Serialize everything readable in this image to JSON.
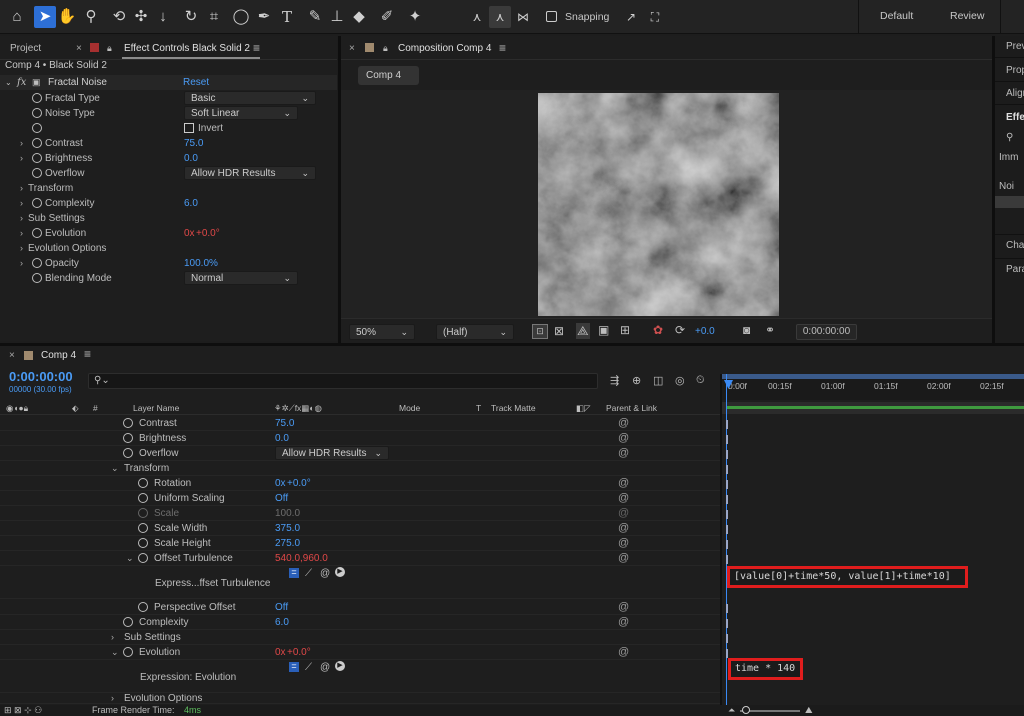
{
  "toolbar": {
    "snapping_label": "Snapping",
    "workspaces": [
      "Default",
      "Review"
    ]
  },
  "left_panel": {
    "tab_project": "Project",
    "tab_effect_controls": "Effect Controls Black Solid 2",
    "layer_path": "Comp 4 • Black Solid 2",
    "effect_name": "Fractal Noise",
    "reset_label": "Reset",
    "props": [
      {
        "label": "Fractal Type",
        "dropdown": "Basic"
      },
      {
        "label": "Noise Type",
        "dropdown": "Soft Linear"
      },
      {
        "label": "",
        "checkbox": "Invert"
      },
      {
        "label": "Contrast",
        "value": "75.0"
      },
      {
        "label": "Brightness",
        "value": "0.0"
      },
      {
        "label": "Overflow",
        "dropdown": "Allow HDR Results"
      },
      {
        "label": "Transform"
      },
      {
        "label": "Complexity",
        "value": "6.0"
      },
      {
        "label": "Sub Settings"
      },
      {
        "label": "Evolution",
        "value_a": "0x",
        "value_b": "+0.0°"
      },
      {
        "label": "Evolution Options"
      },
      {
        "label": "Opacity",
        "value": "100.0%"
      },
      {
        "label": "Blending Mode",
        "dropdown": "Normal"
      }
    ]
  },
  "comp_panel": {
    "tab_label": "Composition Comp 4",
    "comp_chip": "Comp 4",
    "zoom": "50%",
    "resolution": "(Half)",
    "exposure": "+0.0",
    "timecode": "0:00:00:00"
  },
  "right_panel": {
    "items": [
      "Previ",
      "Prop",
      "Align",
      "Effe",
      "Imm",
      "Noi",
      "Char",
      "Para"
    ]
  },
  "timeline": {
    "tab_label": "Comp 4",
    "timecode": "0:00:00:00",
    "frames_fps": "00000 (30.00 fps)",
    "col_layer_name": "Layer Name",
    "col_mode": "Mode",
    "col_t": "T",
    "col_track_matte": "Track Matte",
    "col_parent": "Parent & Link",
    "ruler": [
      "0:00f",
      "00:15f",
      "01:00f",
      "01:15f",
      "02:00f",
      "02:15f"
    ],
    "rows": [
      {
        "name": "Contrast",
        "value": "75.0"
      },
      {
        "name": "Brightness",
        "value": "0.0"
      },
      {
        "name": "Overflow",
        "dropdown": "Allow HDR Results"
      },
      {
        "name": "Transform"
      },
      {
        "name": "Rotation",
        "value_a": "0x",
        "value_b": "+0.0°"
      },
      {
        "name": "Uniform Scaling",
        "value": "Off"
      },
      {
        "name": "Scale",
        "value": "100.0"
      },
      {
        "name": "Scale Width",
        "value": "375.0"
      },
      {
        "name": "Scale Height",
        "value": "275.0"
      },
      {
        "name": "Offset Turbulence",
        "value": "540.0,960.0"
      },
      {
        "name": "Express...ffset Turbulence"
      },
      {
        "name": "Perspective Offset",
        "value": "Off"
      },
      {
        "name": "Complexity",
        "value": "6.0"
      },
      {
        "name": "Sub Settings"
      },
      {
        "name": "Evolution",
        "value_a": "0x",
        "value_b": "+0.0°"
      },
      {
        "name": "Expression: Evolution"
      },
      {
        "name": "Evolution Options"
      }
    ],
    "expr_offset": "[value[0]+time*50, value[1]+time*10]",
    "expr_evolution": "time * 140",
    "status_label": "Frame Render Time:",
    "status_value": "4ms"
  }
}
